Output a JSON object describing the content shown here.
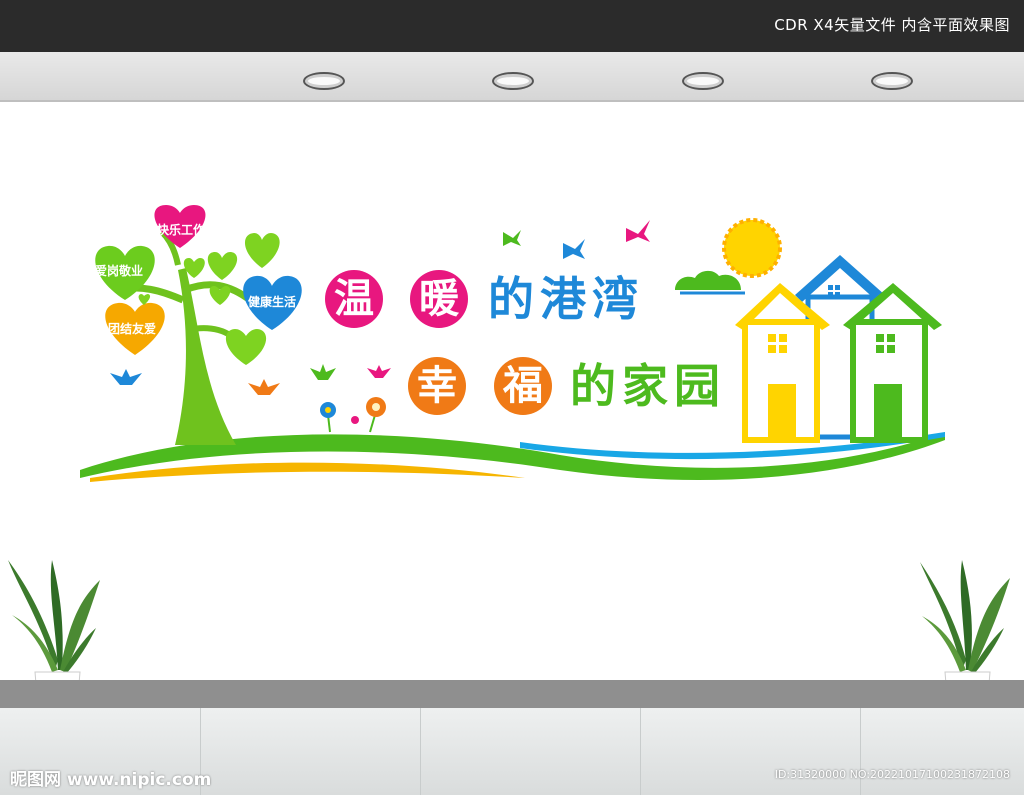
{
  "header": {
    "title": "CDR X4矢量文件  内含平面效果图"
  },
  "headline": {
    "line1": [
      "温",
      "暖",
      "的",
      "港",
      "湾"
    ],
    "line2": [
      "幸",
      "福",
      "的",
      "家",
      "园"
    ]
  },
  "hearts": [
    "快乐工作",
    "爱岗敬业",
    "健康生活",
    "团结友爱"
  ],
  "watermark": {
    "left": "昵图网 www.nipic.com",
    "right": "ID:31320000 NO:20221017100231872108"
  },
  "colors": {
    "pink": "#e8177f",
    "orange": "#f07a16",
    "blue": "#1e88d8",
    "green": "#4dba1e",
    "yellow": "#ffd400",
    "topbar": "#2b2b2b"
  }
}
